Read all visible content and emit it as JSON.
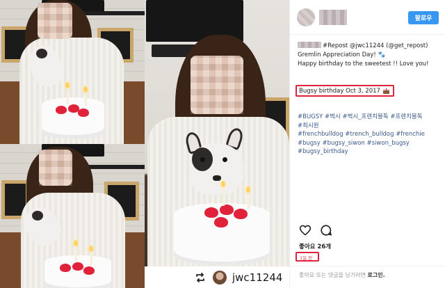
{
  "header": {
    "follow_label": "팔로우"
  },
  "caption": {
    "repost_line": "#Repost @jwc11244 (@get_repost)",
    "line2": "Gremlin Appreciation Day! 🐾",
    "line3": "Happy birthday to the sweetest !! Love you!",
    "date_line": "Bugsy birthday Oct 3, 2017"
  },
  "hashtags": [
    "#BUGSY #벅시 #벅시_프렌치불독 #프렌치불독",
    "#최시원",
    "#frenchbulldog #trench_bulldog #frenchie",
    "#bugsy #bugsy_siwon #siwon_bugsy",
    "#bugsy_birthday"
  ],
  "likes": {
    "label": "좋아요 26개"
  },
  "timestamp": {
    "label": "1일 전"
  },
  "comment": {
    "prompt": "좋아요 또는 댓글을 남기려면",
    "login": "로그인."
  },
  "repost": {
    "username": "jwc11244"
  },
  "icons": {
    "heart": "heart-icon",
    "comment": "comment-icon",
    "repost": "repost-icon"
  },
  "colors": {
    "follow_button": "#3897f0",
    "highlight": "#e0233a",
    "hashtag": "#39588b"
  }
}
